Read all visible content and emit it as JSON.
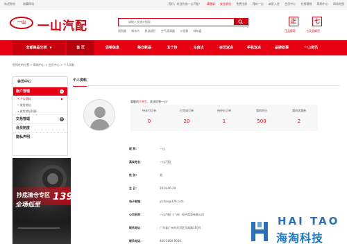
{
  "topbar": {
    "left": [
      "欢迎致电",
      "收藏网站"
    ],
    "welcome": "您好，欢迎光临一山汽配！",
    "login": "请登录",
    "links": [
      "安全退出",
      "免费注册",
      "我的一山",
      "商家入驻",
      "会员中心",
      "在线客服",
      "帮助中心",
      "网站地图"
    ]
  },
  "logo": {
    "mark": "一山",
    "name": "一山汽配"
  },
  "search": {
    "placeholder": "请输入关键字搜索",
    "hotwords": [
      "雨刮器",
      "刹车片",
      "机油滤芯",
      "空气滤清器",
      "火花塞",
      "刹车盘"
    ]
  },
  "badges": [
    {
      "char": "正",
      "label": "正品保证"
    },
    {
      "char": "七",
      "label": "七天退换货"
    }
  ],
  "nav": {
    "category": "全部商品分类",
    "items": [
      "首 页",
      "促销信息",
      "每日新品",
      "五十铃",
      "马自达",
      "会员返点",
      "手机返点",
      "品牌故事",
      "一山资讯"
    ]
  },
  "breadcrumb": "您所在的位置 > 帮助中心 > 会员中心 > 个人资料",
  "sidebar": {
    "title": "会员中心",
    "sections": [
      {
        "label": "账户管理",
        "active": true,
        "subs": [
          {
            "label": "个人资料",
            "active": true
          },
          {
            "label": "收货地址",
            "active": false
          },
          {
            "label": "收货地址列表",
            "active": false
          }
        ]
      },
      {
        "label": "交易管理",
        "active": false,
        "subs": []
      },
      {
        "label": "会员制度",
        "active": false,
        "subs": []
      },
      {
        "label": "隐私声明",
        "active": false,
        "subs": []
      }
    ]
  },
  "ad": {
    "line1": "抄底清仓专区",
    "line2": "全场低至",
    "number": "139"
  },
  "main": {
    "tab": "个人资料",
    "welcome_prefix": "尊敬的",
    "user": "王先生",
    "welcome_suffix": "，欢迎回到一山！",
    "stats": [
      {
        "label": "待支付订单",
        "value": "0"
      },
      {
        "label": "已完成订单",
        "value": "20"
      },
      {
        "label": "待评价订单",
        "value": "1"
      },
      {
        "label": "我的积分",
        "value": "500"
      },
      {
        "label": "我的优惠券",
        "value": "2"
      }
    ],
    "profile": [
      {
        "key": "昵   称：",
        "value": "一山"
      },
      {
        "key": "真实姓名：",
        "value": "一山汽配"
      },
      {
        "key": "性   别：",
        "value": "男"
      },
      {
        "key": "生   日：",
        "value": "2014-06-29"
      },
      {
        "key": "电子邮箱：",
        "value": "yishan@126.com"
      },
      {
        "key": "公司名称：",
        "value": "一山汽配（广州）电子商务有限公司"
      },
      {
        "key": "联系地址：",
        "value": "广东省广州市天河区元岗路310号"
      },
      {
        "key": "联系电话：",
        "value": "400-5000-8000"
      }
    ]
  },
  "watermark": {
    "en": "HAI TAO",
    "cn": "海淘科技"
  },
  "colors": {
    "brand": "#e60012",
    "dark_red": "#c8000e",
    "watermark": "#1e78c8"
  }
}
